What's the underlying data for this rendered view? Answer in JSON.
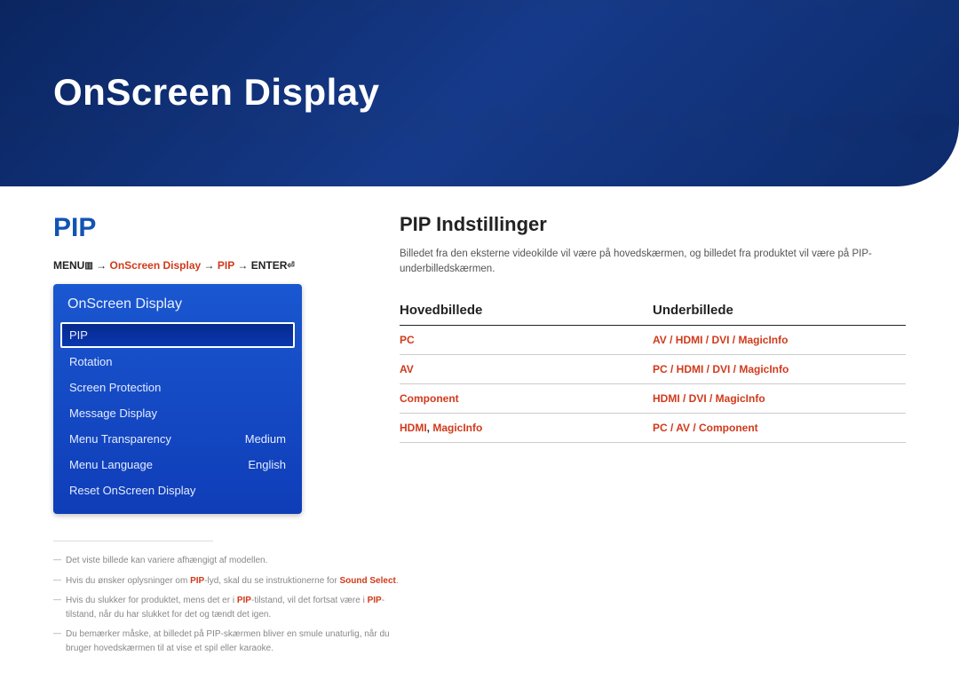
{
  "hero": {
    "title": "OnScreen Display"
  },
  "left": {
    "section_title": "PIP",
    "breadcrumb": {
      "menu": "MENU",
      "arrow": " → ",
      "path1": "OnScreen Display",
      "path2": "PIP",
      "enter": "ENTER"
    },
    "osd": {
      "title": "OnScreen Display",
      "items": [
        {
          "label": "PIP",
          "value": "",
          "selected": true
        },
        {
          "label": "Rotation",
          "value": ""
        },
        {
          "label": "Screen Protection",
          "value": ""
        },
        {
          "label": "Message Display",
          "value": ""
        },
        {
          "label": "Menu Transparency",
          "value": "Medium"
        },
        {
          "label": "Menu Language",
          "value": "English"
        },
        {
          "label": "Reset OnScreen Display",
          "value": ""
        }
      ]
    },
    "notes": [
      {
        "pre": "Det viste billede kan variere afhængigt af modellen.",
        "hl": "",
        "post": ""
      },
      {
        "pre": "Hvis du ønsker oplysninger om ",
        "hl": "PIP",
        "mid": "-lyd, skal du se instruktionerne for ",
        "hl2": "Sound Select",
        "post": "."
      },
      {
        "pre": "Hvis du slukker for produktet, mens det er i ",
        "hl": "PIP",
        "mid": "-tilstand, vil det fortsat være i ",
        "hl2": "PIP",
        "post": "-tilstand, når du har slukket for det og tændt det igen."
      },
      {
        "pre": "Du bemærker måske, at billedet på PIP-skærmen bliver en smule unaturlig, når du bruger hovedskærmen til at vise et spil eller karaoke.",
        "hl": "",
        "post": ""
      }
    ]
  },
  "right": {
    "heading": "PIP Indstillinger",
    "desc": "Billedet fra den eksterne videokilde vil være på hovedskærmen, og billedet fra produktet vil være på PIP-underbilledskærmen.",
    "table": {
      "head1": "Hovedbillede",
      "head2": "Underbillede",
      "rows": [
        {
          "main": "PC",
          "sub": "AV / HDMI / DVI / MagicInfo"
        },
        {
          "main": "AV",
          "sub": "PC / HDMI / DVI / MagicInfo"
        },
        {
          "main": "Component",
          "sub": "HDMI / DVI / MagicInfo"
        },
        {
          "main_a": "HDMI",
          "main_sep": ", ",
          "main_b": "MagicInfo",
          "sub": "PC / AV / Component"
        }
      ]
    }
  }
}
